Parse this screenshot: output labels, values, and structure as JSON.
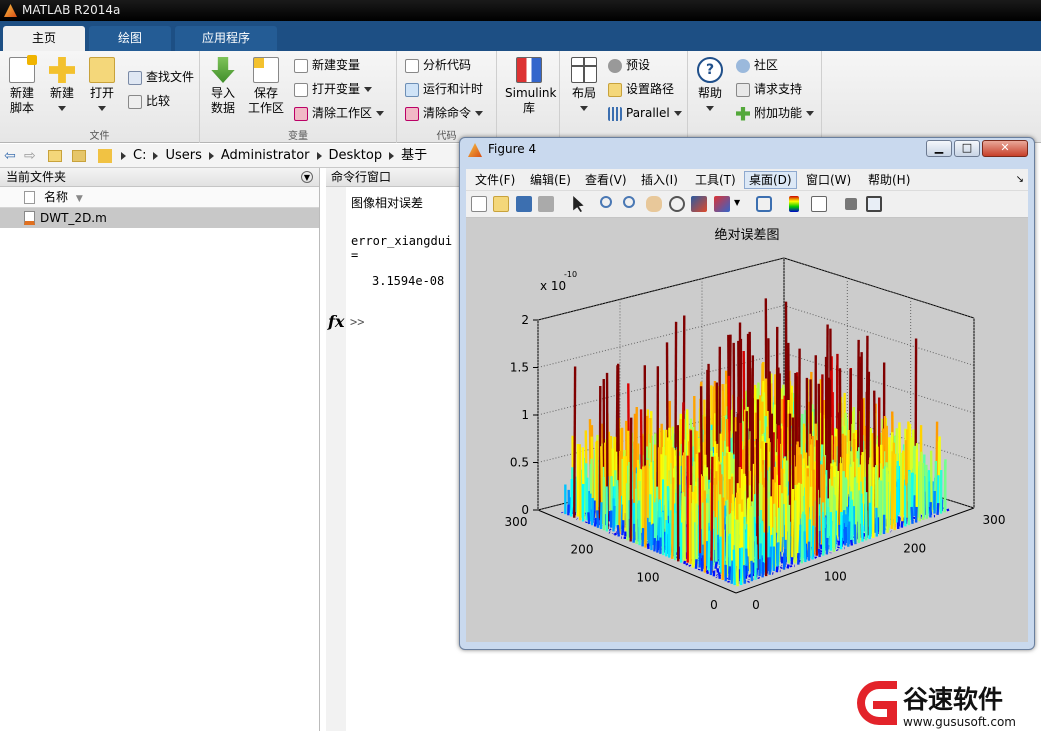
{
  "app": {
    "title": "MATLAB R2014a"
  },
  "tabs": [
    "主页",
    "绘图",
    "应用程序"
  ],
  "ribbon": {
    "file_group": {
      "label": "文件",
      "new_script": [
        "新建",
        "脚本"
      ],
      "new": "新建",
      "open": "打开",
      "find_files": "查找文件",
      "compare": "比较"
    },
    "variable_group": {
      "label": "变量",
      "import": [
        "导入",
        "数据"
      ],
      "save": [
        "保存",
        "工作区"
      ],
      "new_var": "新建变量",
      "open_var": "打开变量",
      "clear_ws": "清除工作区"
    },
    "code_group": {
      "label": "代码",
      "analyze": "分析代码",
      "run_time": "运行和计时",
      "clear_cmd": "清除命令"
    },
    "simulink_group": {
      "simulink": [
        "Simulink",
        "库"
      ]
    },
    "env_group": {
      "layout": "布局",
      "prefs": "预设",
      "set_path": "设置路径",
      "parallel": "Parallel"
    },
    "resources_group": {
      "help": "帮助",
      "community": "社区",
      "request_support": "请求支持",
      "addons": "附加功能"
    }
  },
  "address": {
    "path": [
      "C:",
      "Users",
      "Administrator",
      "Desktop",
      "基于matlab"
    ]
  },
  "current_folder": {
    "title": "当前文件夹",
    "col_name": "名称",
    "files": [
      "DWT_2D.m"
    ]
  },
  "command_window": {
    "title": "命令行窗口",
    "lines": [
      "图像相对误差",
      "error_xiangdui =",
      "3.1594e-08"
    ],
    "fx": "fx",
    "prompt": ">>"
  },
  "figure": {
    "title": "Figure 4",
    "menu": [
      "文件(F)",
      "编辑(E)",
      "查看(V)",
      "插入(I)",
      "工具(T)",
      "桌面(D)",
      "窗口(W)",
      "帮助(H)"
    ],
    "plot_title": "绝对误差图",
    "exponent_label": "x 10",
    "exponent_power": "-10",
    "z_ticks": [
      "0",
      "0.5",
      "1",
      "1.5",
      "2"
    ],
    "y_ticks": [
      "0",
      "100",
      "200",
      "300"
    ],
    "x_ticks": [
      "0",
      "100",
      "200",
      "300"
    ]
  },
  "chart_data": {
    "type": "surface",
    "title": "绝对误差图",
    "zlim": [
      0,
      2
    ],
    "zscale_exponent": -10,
    "xlim": [
      0,
      300
    ],
    "ylim": [
      0,
      300
    ],
    "colormap": "jet",
    "grid": true
  },
  "watermark": {
    "brand": "谷速软件",
    "url": "www.gususoft.com"
  },
  "colors": {
    "tabstrip": "#1d4f84",
    "accent_red": "#e3232a"
  }
}
